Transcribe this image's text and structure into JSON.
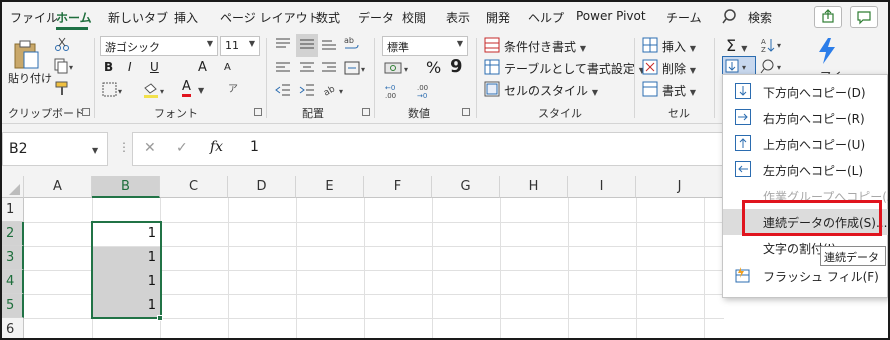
{
  "menu": {
    "tabs": [
      "ファイル",
      "ホーム",
      "新しいタブ",
      "挿入",
      "ページ レイアウト",
      "数式",
      "データ",
      "校閲",
      "表示",
      "開発",
      "ヘルプ",
      "Power Pivot",
      "チーム"
    ],
    "active_tab": "ホーム",
    "search_label": "検索"
  },
  "ribbon": {
    "clipboard": {
      "paste_label": "貼り付け",
      "group_label": "クリップボード"
    },
    "font": {
      "name": "游ゴシック",
      "size": "11",
      "bold": "B",
      "italic": "I",
      "underline": "U",
      "grow": "A",
      "shrink": "A",
      "color_letter": "A",
      "group_label": "フォント"
    },
    "alignment": {
      "group_label": "配置"
    },
    "number": {
      "format": "標準",
      "percent": "%",
      "comma": "9",
      "group_label": "数値"
    },
    "style": {
      "conditional": "条件付き書式",
      "table": "テーブルとして書式設定",
      "cell_style": "セルのスタイル",
      "group_label": "スタイル"
    },
    "cells": {
      "insert": "挿入",
      "delete": "削除",
      "format": "書式",
      "group_label": "セル"
    },
    "editing": {
      "sum_symbol": "Σ",
      "partial_label": "アイ"
    }
  },
  "formula_bar": {
    "name_box": "B2",
    "formula": "1",
    "fx": "fx"
  },
  "sheet": {
    "columns": [
      "A",
      "B",
      "C",
      "D",
      "E",
      "F",
      "G",
      "H",
      "I",
      "J"
    ],
    "rows": [
      "1",
      "2",
      "3",
      "4",
      "5",
      "6"
    ],
    "selected_column": "B",
    "cells": [
      {
        "ref": "B2",
        "value": "1"
      },
      {
        "ref": "B3",
        "value": "1"
      },
      {
        "ref": "B4",
        "value": "1"
      },
      {
        "ref": "B5",
        "value": "1"
      }
    ]
  },
  "fill_menu": {
    "items": [
      {
        "label": "下方向へコピー(D)",
        "icon": "arrow-down-icon",
        "enabled": true
      },
      {
        "label": "右方向へコピー(R)",
        "icon": "arrow-right-icon",
        "enabled": true
      },
      {
        "label": "上方向へコピー(U)",
        "icon": "arrow-up-icon",
        "enabled": true
      },
      {
        "label": "左方向へコピー(L)",
        "icon": "arrow-left-icon",
        "enabled": true
      },
      {
        "label": "作業グループへコピー(A)...",
        "icon": "",
        "enabled": false
      },
      {
        "label": "連続データの作成(S)...",
        "icon": "",
        "enabled": true
      },
      {
        "label": "文字の割付(J)",
        "icon": "",
        "enabled": true
      },
      {
        "label": "フラッシュ フィル(F)",
        "icon": "flash-fill-icon",
        "enabled": true
      }
    ],
    "tooltip": "連続データ"
  },
  "colors": {
    "accent_green": "#217346",
    "highlight_red": "#e0141e",
    "selection_gray": "#d2d2d2"
  }
}
